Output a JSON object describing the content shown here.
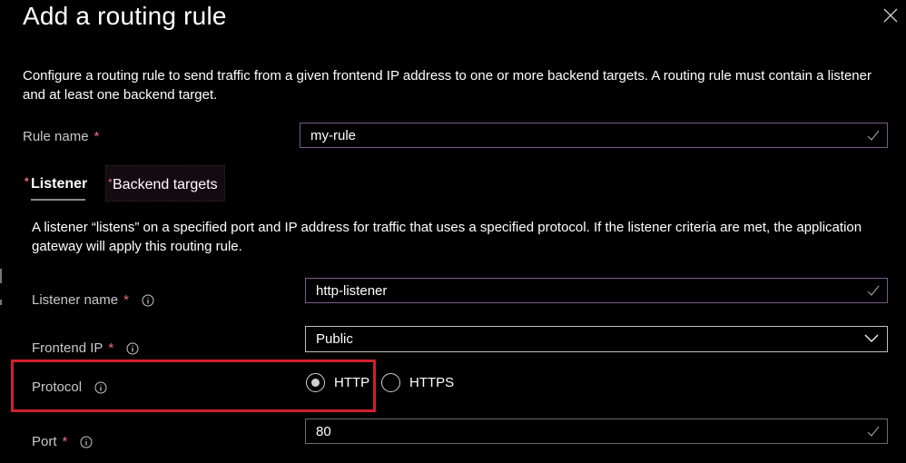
{
  "panel": {
    "title": "Add a routing rule",
    "description": "Configure a routing rule to send traffic from a given frontend IP address to one or more backend targets. A routing rule must contain a listener and at least one backend target."
  },
  "rule_name": {
    "label": "Rule name",
    "required_mark": "*",
    "value": "my-rule"
  },
  "tabs": [
    {
      "label": "Listener",
      "required_mark": "*",
      "selected": true
    },
    {
      "label": "Backend targets",
      "required_mark": "*",
      "selected": false
    }
  ],
  "listener": {
    "description": "A listener “listens” on a specified port and IP address for traffic that uses a specified protocol. If the listener criteria are met, the application gateway will apply this routing rule.",
    "listener_name": {
      "label": "Listener name",
      "required_mark": "*",
      "value": "http-listener"
    },
    "frontend_ip": {
      "label": "Frontend IP",
      "required_mark": "*",
      "value": "Public"
    },
    "protocol": {
      "label": "Protocol",
      "options": [
        "HTTP",
        "HTTPS"
      ],
      "selected": "HTTP"
    },
    "port": {
      "label": "Port",
      "required_mark": "*",
      "value": "80"
    }
  },
  "colors": {
    "background": "#000000",
    "required": "#f1707b",
    "highlight": "#d0202e"
  },
  "icons": {
    "close": "close-icon",
    "info": "info-icon",
    "check": "checkmark-icon",
    "dropdown": "chevron-down-icon"
  }
}
